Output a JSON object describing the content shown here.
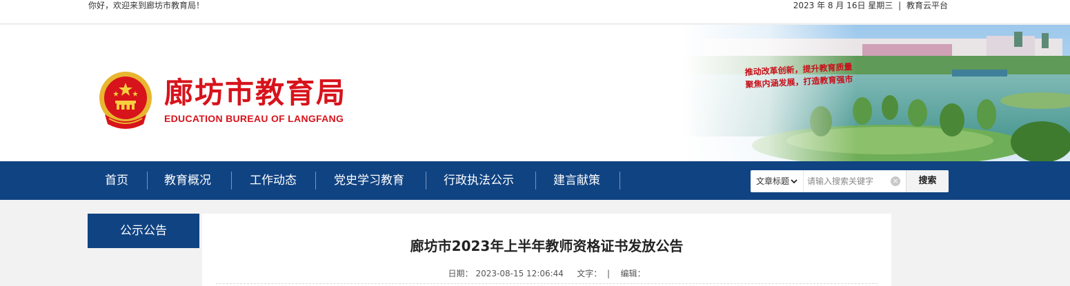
{
  "topbar": {
    "welcome": "你好，欢迎来到廊坊市教育局！",
    "date": "2023 年 8 月 16日 星期三",
    "separator": "|",
    "cloud_link": "教育云平台"
  },
  "header": {
    "title_cn": "廊坊市教育局",
    "title_en": "EDUCATION BUREAU OF LANGFANG",
    "slogan_line1": "推动改革创新，提升教育质量",
    "slogan_line2": "聚焦内涵发展，打造教育强市"
  },
  "nav": {
    "items": [
      {
        "label": "首页"
      },
      {
        "label": "教育概况"
      },
      {
        "label": "工作动态"
      },
      {
        "label": "党史学习教育"
      },
      {
        "label": "行政执法公示"
      },
      {
        "label": "建言献策"
      }
    ]
  },
  "search": {
    "scope": "文章标题",
    "placeholder": "请输入搜索关键字",
    "button": "搜索",
    "clear": "×"
  },
  "sidebar": {
    "title": "公示公告"
  },
  "article": {
    "title": "廊坊市2023年上半年教师资格证书发放公告",
    "date_label": "日期：",
    "date": "2023-08-15 12:06:44",
    "text_label": "文字：",
    "bar": "|",
    "editor_label": "编辑："
  },
  "colors": {
    "nav_bg": "#104382",
    "brand_red": "#d7131b",
    "page_bg": "#f2f2f2"
  },
  "icons": {
    "emblem": "national-emblem-icon",
    "dropdown": "chevron-down-icon",
    "clear": "clear-icon"
  }
}
